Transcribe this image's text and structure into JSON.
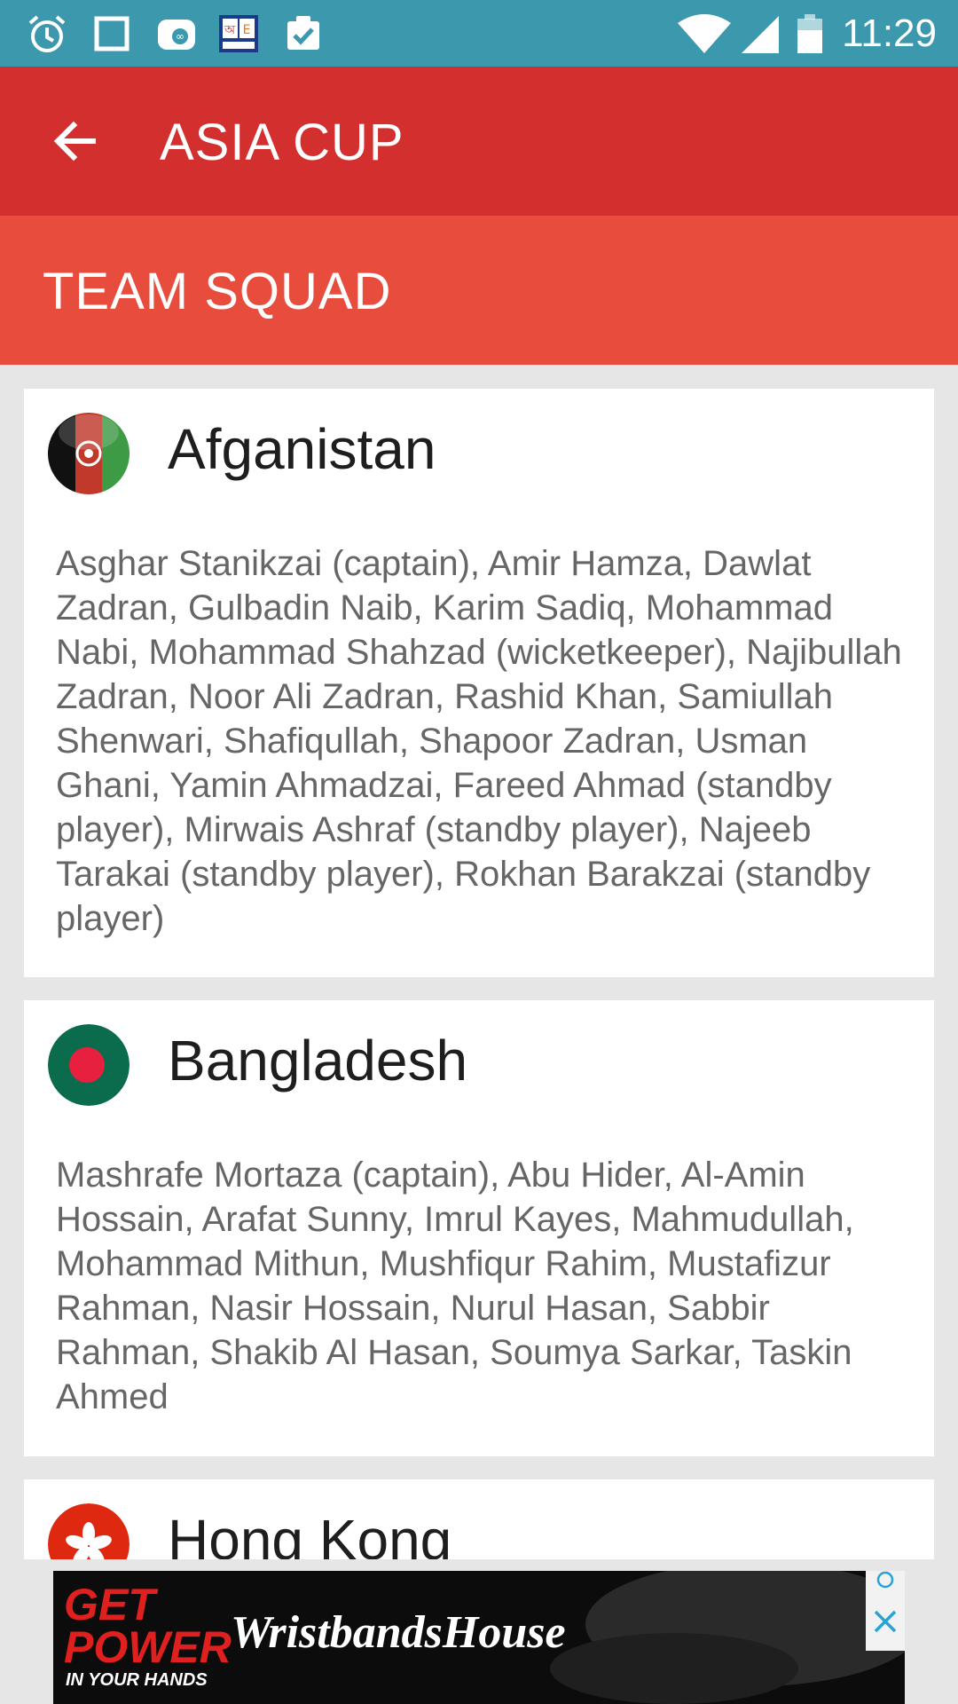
{
  "status_bar": {
    "time": "11:29",
    "left_icons": [
      "alarm-icon",
      "square-icon",
      "piggy-icon",
      "dictionary-app-icon",
      "clipboard-check-icon"
    ],
    "right_icons": [
      "wifi-icon",
      "signal-icon",
      "battery-icon"
    ]
  },
  "app_bar": {
    "title": "ASIA CUP",
    "back_icon": "arrow-back-icon"
  },
  "section": {
    "title": "TEAM SQUAD"
  },
  "teams": [
    {
      "name": "Afganistan",
      "squad": "Asghar Stanikzai (captain), Amir Hamza, Dawlat Zadran, Gulbadin Naib, Karim Sadiq, Mohammad Nabi, Mohammad Shahzad (wicketkeeper), Najibullah Zadran, Noor Ali Zadran, Rashid Khan, Samiullah Shenwari, Shafiqullah, Shapoor Zadran, Usman Ghani, Yamin Ahmadzai, Fareed Ahmad (standby player), Mirwais Ashraf (standby player), Najeeb Tarakai (standby player), Rokhan Barakzai (standby player)"
    },
    {
      "name": "Bangladesh",
      "squad": "Mashrafe Mortaza (captain), Abu Hider, Al-Amin Hossain, Arafat Sunny, Imrul Kayes, Mahmudullah, Mohammad Mithun, Mushfiqur Rahim, Mustafizur Rahman, Nasir Hossain, Nurul Hasan, Sabbir Rahman, Shakib Al Hasan, Soumya Sarkar, Taskin Ahmed"
    },
    {
      "name": "Hong Kong",
      "squad": ""
    }
  ],
  "ad": {
    "headline": "GET POWER",
    "tagline": "IN YOUR HANDS",
    "brand": "WristbandsHouse",
    "close_icon": "close-icon",
    "info_icon": "ad-info-icon"
  },
  "colors": {
    "status_bar": "#3b98ad",
    "app_bar": "#d32f2f",
    "sub_bar": "#e84c3d",
    "background": "#e6e6e6",
    "card": "#ffffff"
  }
}
